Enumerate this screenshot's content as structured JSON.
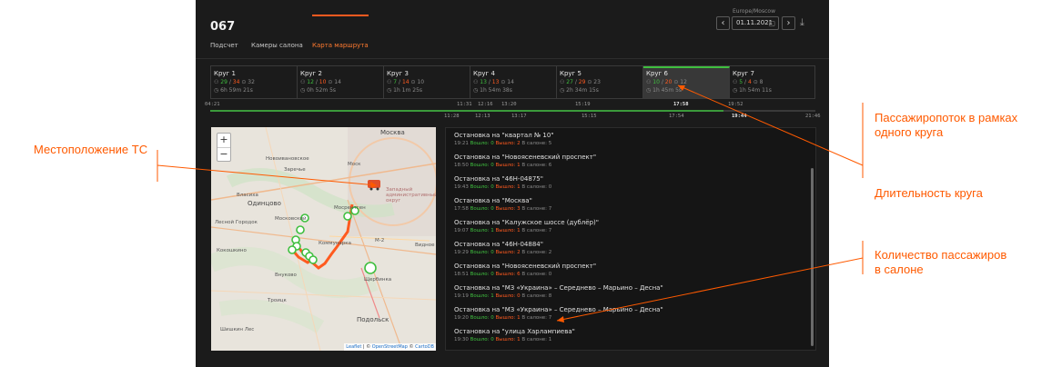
{
  "header": {
    "title": "067",
    "timezone": "Europe/Moscow",
    "date": "01.11.2021",
    "prev_icon": "‹",
    "next_icon": "›",
    "calendar_icon": "▢",
    "download_icon": "⤓"
  },
  "tabs": [
    {
      "label": "Подсчет",
      "active": false
    },
    {
      "label": "Камеры салона",
      "active": false
    },
    {
      "label": "Карта маршрута",
      "active": true
    }
  ],
  "rounds": [
    {
      "name": "Круг 1",
      "in": "29",
      "out": "34",
      "onboard": "32",
      "duration": "6h 59m 21s"
    },
    {
      "name": "Круг 2",
      "in": "12",
      "out": "10",
      "onboard": "14",
      "duration": "0h 52m 5s"
    },
    {
      "name": "Круг 3",
      "in": "7",
      "out": "14",
      "onboard": "10",
      "duration": "1h 1m 25s"
    },
    {
      "name": "Круг 4",
      "in": "13",
      "out": "13",
      "onboard": "14",
      "duration": "1h 54m 38s"
    },
    {
      "name": "Круг 5",
      "in": "27",
      "out": "29",
      "onboard": "23",
      "duration": "2h 34m 15s"
    },
    {
      "name": "Круг 6",
      "in": "10",
      "out": "20",
      "onboard": "12",
      "duration": "1h 45m 5s",
      "active": true
    },
    {
      "name": "Круг 7",
      "in": "5",
      "out": "4",
      "onboard": "8",
      "duration": "1h 54m 11s"
    }
  ],
  "timeline": {
    "top": [
      "04:21",
      "11:31",
      "12:16",
      "13:20",
      "15:19",
      "17:58",
      "19:52"
    ],
    "bottom": [
      "11:28",
      "12:13",
      "13:17",
      "15:15",
      "17:54",
      "19:44",
      "21:46"
    ]
  },
  "map": {
    "zoom_in": "+",
    "zoom_out": "−",
    "labels": [
      "Москва",
      "Новоивановское",
      "Заречье",
      "Власиха",
      "Одинцово",
      "Лесной Городок",
      "Кокошкино",
      "Московский",
      "Мосрентген",
      "Коммунарка",
      "Внуково",
      "Троицк",
      "Подольск",
      "Щербинка",
      "Шишкин Лес",
      "Видное",
      "М-2",
      "Западный административный округ",
      "Моск"
    ],
    "attribution_leaflet": "Leaflet",
    "attribution_sep": " | © ",
    "attribution_osm": "OpenStreetMap",
    "attribution_sep2": " © ",
    "attribution_carto": "CartoDB",
    "colors": {
      "route": "#ff5a1f",
      "stop": "#3fbf3f",
      "bus": "#e0502a"
    }
  },
  "stops_labels": {
    "in": "Вошло:",
    "out": "Вышло:",
    "onboard": "В салоне:"
  },
  "stops": [
    {
      "name": "Остановка на \"квартал № 10\"",
      "time": "19:21",
      "in": "0",
      "out": "2",
      "onboard": "5"
    },
    {
      "name": "Остановка на \"Новоясеневский проспект\"",
      "time": "18:50",
      "in": "0",
      "out": "1",
      "onboard": "6"
    },
    {
      "name": "Остановка на \"46Н-04875\"",
      "time": "19:43",
      "in": "0",
      "out": "1",
      "onboard": "0"
    },
    {
      "name": "Остановка на \"Москва\"",
      "time": "17:58",
      "in": "0",
      "out": "3",
      "onboard": "7"
    },
    {
      "name": "Остановка на \"Калужское шоссе (дублёр)\"",
      "time": "19:07",
      "in": "1",
      "out": "1",
      "onboard": "7"
    },
    {
      "name": "Остановка на \"46Н-04884\"",
      "time": "19:29",
      "in": "0",
      "out": "2",
      "onboard": "2"
    },
    {
      "name": "Остановка на \"Новоясеневский проспект\"",
      "time": "18:51",
      "in": "0",
      "out": "6",
      "onboard": "0"
    },
    {
      "name": "Остановка на \"МЗ «Украина» – Середнево – Марьино – Десна\"",
      "time": "19:19",
      "in": "1",
      "out": "0",
      "onboard": "8"
    },
    {
      "name": "Остановка на \"МЗ «Украина» – Середнево – Марьино – Десна\"",
      "time": "19:20",
      "in": "0",
      "out": "1",
      "onboard": "7"
    },
    {
      "name": "Остановка на \"улица Харлампиева\"",
      "time": "19:30",
      "in": "0",
      "out": "1",
      "onboard": "1"
    }
  ],
  "annotations": {
    "vehicle_location": "Местоположение ТС",
    "passenger_flow": [
      "Пассажиропоток в рамках",
      "одного круга"
    ],
    "round_duration": "Длительность круга",
    "passengers_onboard": [
      "Количество пассажиров",
      "в салоне"
    ]
  }
}
